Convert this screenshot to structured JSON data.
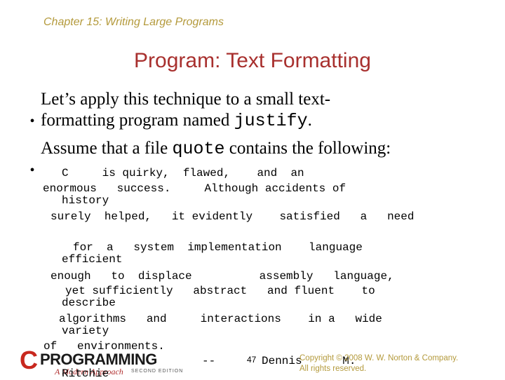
{
  "header": {
    "chapter": "Chapter 15: Writing Large Programs"
  },
  "slide": {
    "title": "Program: Text Formatting",
    "bullets": [
      {
        "line1": "Let’s apply this technique to a small text-",
        "line2_pre": "formatting program named ",
        "line2_code": "justify",
        "line2_post": "."
      },
      {
        "pre": "Assume that a file ",
        "code": "quote",
        "post": " contains the following:"
      }
    ],
    "bullet_glyph": "•",
    "quote_lines": [
      "C     is quirky,  flawed,    and  an",
      "enormous   success.     Although accidents of",
      "history",
      "surely  helped,   it evidently    satisfied   a   need",
      "for  a   system  implementation    language",
      "efficient",
      "enough   to  displace          assembly   language,",
      "yet sufficiently   abstract   and fluent    to",
      "describe",
      "algorithms   and     interactions    in a   wide",
      "variety",
      "of   environments.",
      "--",
      "Dennis      M.",
      "Ritchie"
    ]
  },
  "footer": {
    "logo_letter": "C",
    "logo_word": "PROGRAMMING",
    "logo_subtitle": "A Modern Approach",
    "logo_edition": "SECOND EDITION",
    "page_number": "47",
    "copyright_line1": "Copyright © 2008 W. W. Norton & Company.",
    "copyright_line2": "All rights reserved."
  },
  "colors": {
    "chapter": "#b49a3c",
    "title": "#a8302e",
    "logo_red": "#c8281e"
  }
}
